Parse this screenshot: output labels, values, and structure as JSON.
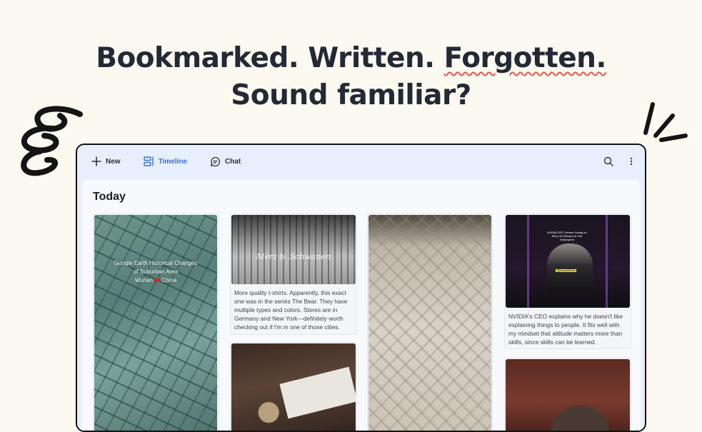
{
  "hero": {
    "line1_part1": "Bookmarked. Written.",
    "line1_part2": "Forgotten.",
    "line2": "Sound familiar?"
  },
  "toolbar": {
    "new_label": "New",
    "timeline_label": "Timeline",
    "chat_label": "Chat"
  },
  "section": {
    "title": "Today"
  },
  "cards": {
    "map": {
      "line1": "Google Earth Historical Changes",
      "line2": "of Suburban Area",
      "line3_a": "Wuhan",
      "line3_b": "China"
    },
    "tshirt": {
      "brand": "Merz b. Schwanen",
      "caption": "More quality t-shirts. Apparently, this exact one was in the series The Bear. They have multiple types and colors. Stores are in Germany and New York—definitely worth checking out if I'm in one of those cities."
    },
    "nvidia": {
      "video_title": "NVIDIA CEO Jensen Huang on Why He Refuses to Fire Employees",
      "video_tag": "@the.goodnews",
      "caption": "NVIDIA's CEO explains why he doesn't like explaining things to people. It fits well with my mindset that attitude matters more than skills, since skills can be learned."
    }
  },
  "colors": {
    "accent": "#3b6fd4",
    "underline": "#e05a50",
    "background": "#fcf9f0",
    "app_bg": "#e7effc"
  },
  "icons": {
    "new": "plus-icon",
    "timeline": "timeline-icon",
    "chat": "chat-bubble-icon",
    "search": "search-icon",
    "more": "more-vertical-icon"
  }
}
